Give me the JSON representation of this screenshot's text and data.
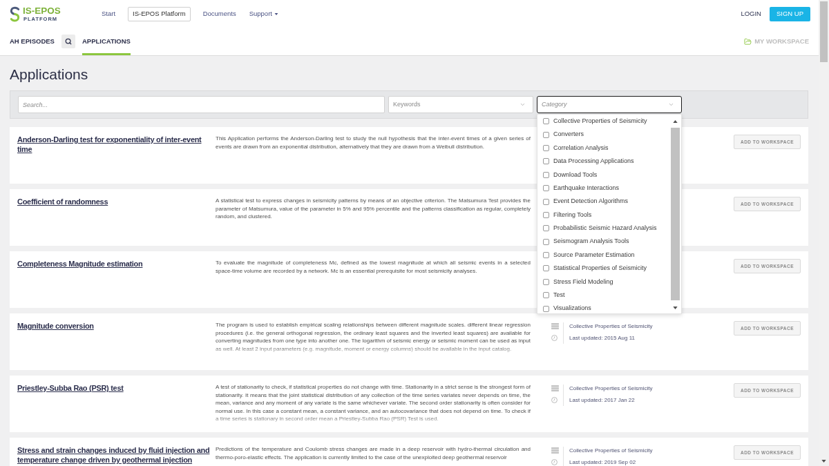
{
  "header": {
    "logo": {
      "name": "IS-EPOS",
      "tagline": "PLATFORM"
    },
    "nav": [
      {
        "kind": "link",
        "label": "Start",
        "selected": false
      },
      {
        "kind": "link",
        "label": "IS-EPOS Platform",
        "selected": true
      },
      {
        "kind": "link",
        "label": "Documents",
        "selected": false
      },
      {
        "kind": "menu",
        "label": "Support",
        "selected": false
      }
    ],
    "login": "LOGIN",
    "signup": "SIGN UP"
  },
  "subnav": {
    "items": [
      {
        "kind": "tab",
        "label": "AH EPISODES",
        "selected": false
      },
      {
        "kind": "search"
      },
      {
        "kind": "tab",
        "label": "APPLICATIONS",
        "selected": true
      }
    ],
    "workspace": {
      "label": "MY WORKSPACE",
      "disabled": true
    }
  },
  "page_title": "Applications",
  "filters": {
    "search": {
      "placeholder": "Search..."
    },
    "keywords": {
      "placeholder": "Keywords"
    },
    "category": {
      "placeholder": "Category",
      "expanded": true,
      "options": [
        {
          "label": "Collective Properties of Seismicity",
          "checked": false
        },
        {
          "label": "Converters",
          "checked": false
        },
        {
          "label": "Correlation Analysis",
          "checked": false
        },
        {
          "label": "Data Processing Applications",
          "checked": false
        },
        {
          "label": "Download Tools",
          "checked": false
        },
        {
          "label": "Earthquake Interactions",
          "checked": false
        },
        {
          "label": "Event Detection Algorithms",
          "checked": false
        },
        {
          "label": "Filtering Tools",
          "checked": false
        },
        {
          "label": "Probabilistic Seismic Hazard Analysis",
          "checked": false
        },
        {
          "label": "Seismogram Analysis Tools",
          "checked": false
        },
        {
          "label": "Source Parameter Estimation",
          "checked": false
        },
        {
          "label": "Statistical Properties of Seismicity",
          "checked": false
        },
        {
          "label": "Stress Field Modeling",
          "checked": false
        },
        {
          "label": "Test",
          "checked": false
        },
        {
          "label": "Visualizations",
          "checked": false
        }
      ]
    }
  },
  "applications": [
    {
      "title": "Anderson-Darling test for exponentiality of inter-event time",
      "description": "This Application performs the Anderson-Darling test to study the null hypothesis that the inter-event times of a given series of events are drawn from an exponential distribution, alternatively that they are drawn from a Weibull distribution.",
      "clipped": false,
      "button": "ADD TO WORKSPACE"
    },
    {
      "title": "Coefficient of randomness",
      "description": "A statistical test to express changes in seismicity patterns by means of an objective criterion. The Matsumura Test provides the parameter of Matsumura, value of the parameter in 5% and 95% percentile and the patterns classification as regular, completely random, and clustered.",
      "clipped": false,
      "button": "ADD TO WORKSPACE"
    },
    {
      "title": "Completeness Magnitude estimation",
      "description": "To evaluate the magnitude of completeness Mc, defined as the lowest magnitude at which all seismic events in a selected space-time volume are recorded by a network. Mc is an essential prerequisite for most seismicity analyses.",
      "clipped": false,
      "button": "ADD TO WORKSPACE"
    },
    {
      "title": "Magnitude conversion",
      "description": "The program is used to establish empirical scaling relationships between different magnitude scales. different linear regression procedures (i.e. the general orthogonal regression, the ordinary least squares and the inverted least squares) are available for converting magnitudes from one type into another one. The logarithm of seismic energy or seismic moment can be used as input as well. At least 2 input parameters (e.g. magnitude, moment or energy columns) should be available in the input catalog.",
      "clipped": true,
      "category": "Collective Properties of Seismicity",
      "last_updated": "Last updated: 2015 Aug 11",
      "button": "ADD TO WORKSPACE"
    },
    {
      "title": "Priestley-Subba Rao (PSR) test",
      "description": "A test of stationarity to check, if statistical properties do not change with time. Stationarity in a strict sense is the strongest form of stationarity. It means that the joint statistical distribution of any collection of the time series variates never depends on time, the mean, variance and any moment of any variate is the same whichever variate. The second order stationarity is often consider for normal use. In this case a constant mean, a constant variance, and an autocovariance that does not depend on time. To check if a time series is stationary in second order mean a Priestley-Subba Rao (PSR) Test is used.",
      "clipped": true,
      "category": "Collective Properties of Seismicity",
      "last_updated": "Last updated: 2017 Jan 22",
      "button": "ADD TO WORKSPACE"
    },
    {
      "title": "Stress and strain changes induced by fluid injection and temperature change driven by geothermal injection",
      "description": "Predictions of the temperature and Coulomb stress changes are made in a deep reservoir with hydro-thermal circulation and thermo-poro-elastic effects. The application is currently limited to the case of the unexploited deep geothermal reservoir",
      "clipped": false,
      "category": "Collective Properties of Seismicity",
      "last_updated": "Last updated: 2019 Sep 02",
      "button": "ADD TO WORKSPACE"
    }
  ]
}
